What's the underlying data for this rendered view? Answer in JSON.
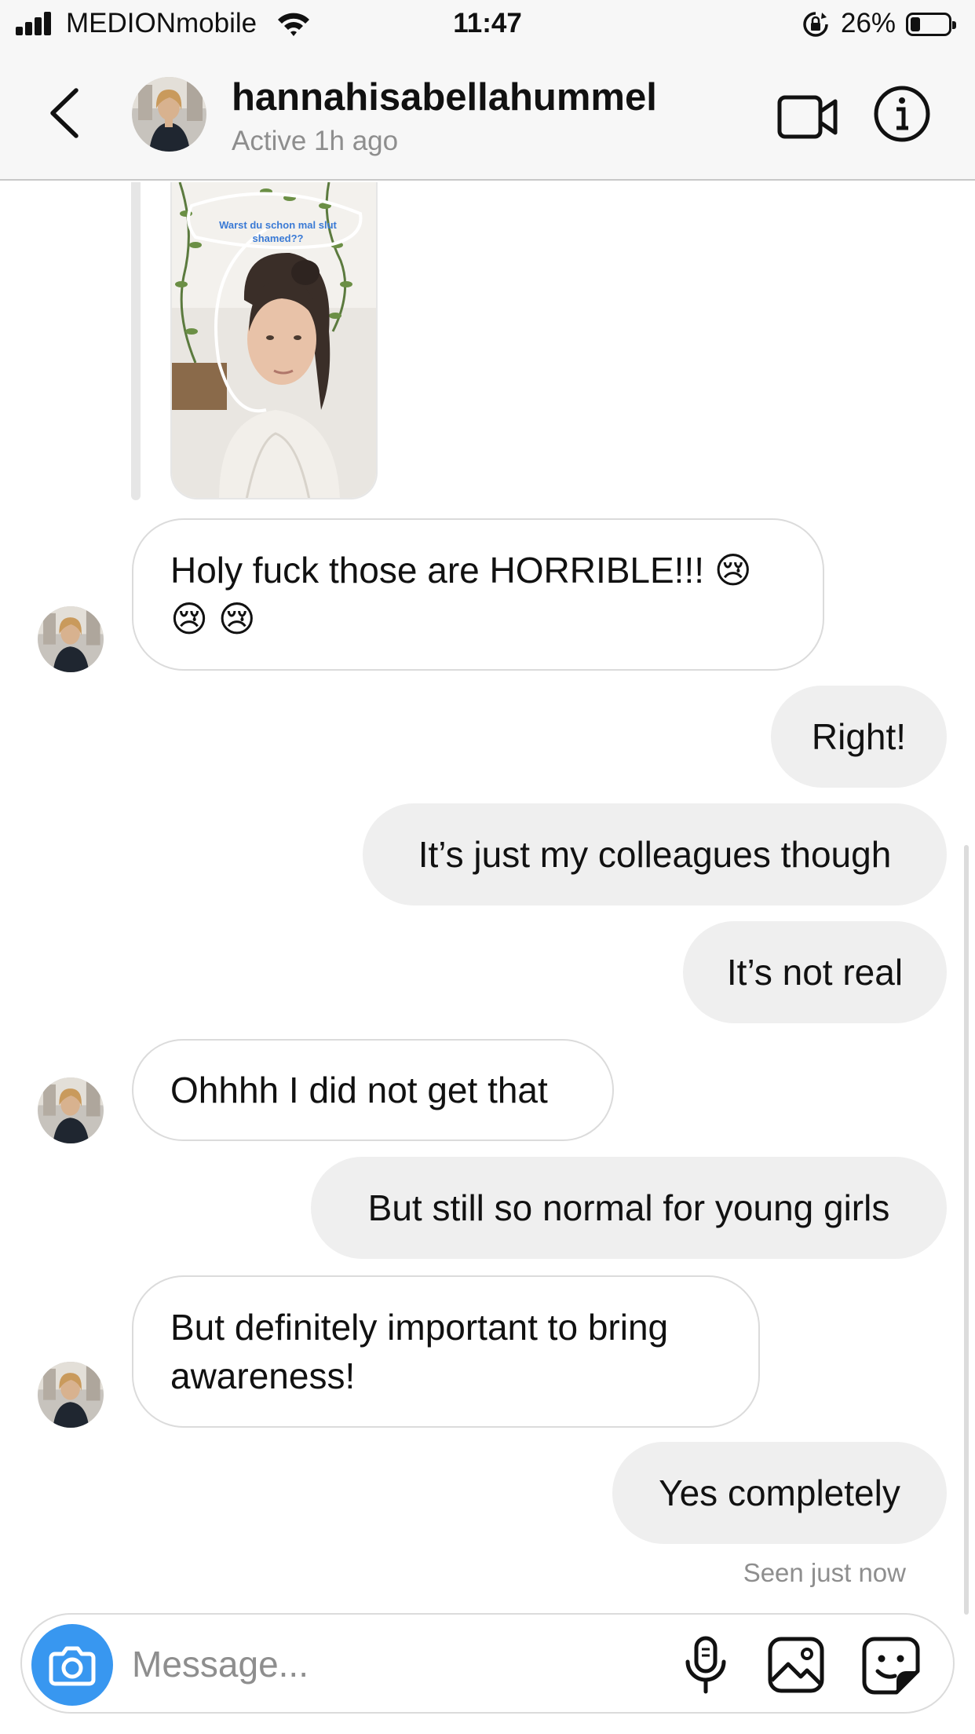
{
  "status_bar": {
    "carrier": "MEDIONmobile",
    "time": "11:47",
    "battery_percent": "26%",
    "battery_level": 0.26
  },
  "header": {
    "username": "hannahisabellahummel",
    "active_status": "Active 1h ago"
  },
  "story_reply": {
    "caption": "Warst du schon mal slut shamed??"
  },
  "messages": [
    {
      "from": "them",
      "line1": "Holy fuck those are HORRIBLE!!! 😢",
      "line2": "😢 😢"
    },
    {
      "from": "me",
      "text": "Right!"
    },
    {
      "from": "me",
      "text": "It’s just my colleagues though"
    },
    {
      "from": "me",
      "text": "It’s not real"
    },
    {
      "from": "them",
      "text": "Ohhhh I did not get that"
    },
    {
      "from": "me",
      "text": "But still so normal for young girls"
    },
    {
      "from": "them",
      "line1": "But definitely important to bring",
      "line2": "awareness!"
    },
    {
      "from": "me",
      "text": "Yes completely"
    }
  ],
  "seen_status": "Seen just now",
  "composer": {
    "placeholder": "Message..."
  },
  "colors": {
    "accent": "#3897f0",
    "outgoing_bubble": "#efefef",
    "incoming_border": "#dbdbdb",
    "secondary_text": "#8e8e8e"
  }
}
